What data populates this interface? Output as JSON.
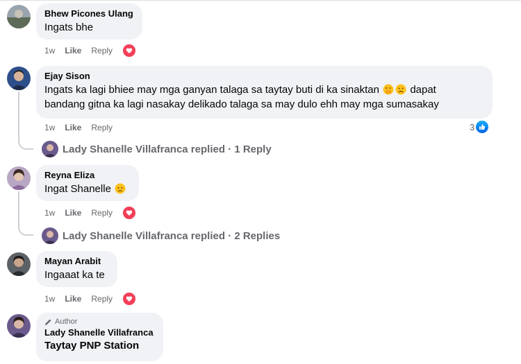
{
  "comments": [
    {
      "name": "Bhew Picones Ulang",
      "text": "Ingats bhe",
      "time": "1w",
      "like": "Like",
      "reply": "Reply"
    },
    {
      "name": "Ejay Sison",
      "line1": "Ingats ka lagi bhiee may mga ganyan talaga sa taytay buti di ka sinaktan",
      "line1_after": "dapat",
      "line2": "bandang gitna ka lagi nasakay delikado talaga sa may dulo ehh may mga sumasakay",
      "time": "1w",
      "like": "Like",
      "reply": "Reply",
      "reaction_count": "3",
      "replied": "Lady Shanelle Villafranca replied · 1 Reply"
    },
    {
      "name": "Reyna Eliza",
      "text": "Ingat Shanelle",
      "time": "1w",
      "like": "Like",
      "reply": "Reply",
      "replied": "Lady Shanelle Villafranca replied · 2 Replies"
    },
    {
      "name": "Mayan Arabit",
      "text": "Ingaaat ka te",
      "time": "1w",
      "like": "Like",
      "reply": "Reply"
    },
    {
      "author_badge": "Author",
      "name": "Lady Shanelle Villafranca",
      "text": "Taytay PNP Station"
    }
  ],
  "icons": {
    "heart": "heart-reaction-icon",
    "like": "like-reaction-icon",
    "pencil": "pencil-icon"
  },
  "colors": {
    "bubble": "#f0f2f5",
    "heart": "#f33e58",
    "like": "#0866ff",
    "meta": "#65676b"
  }
}
